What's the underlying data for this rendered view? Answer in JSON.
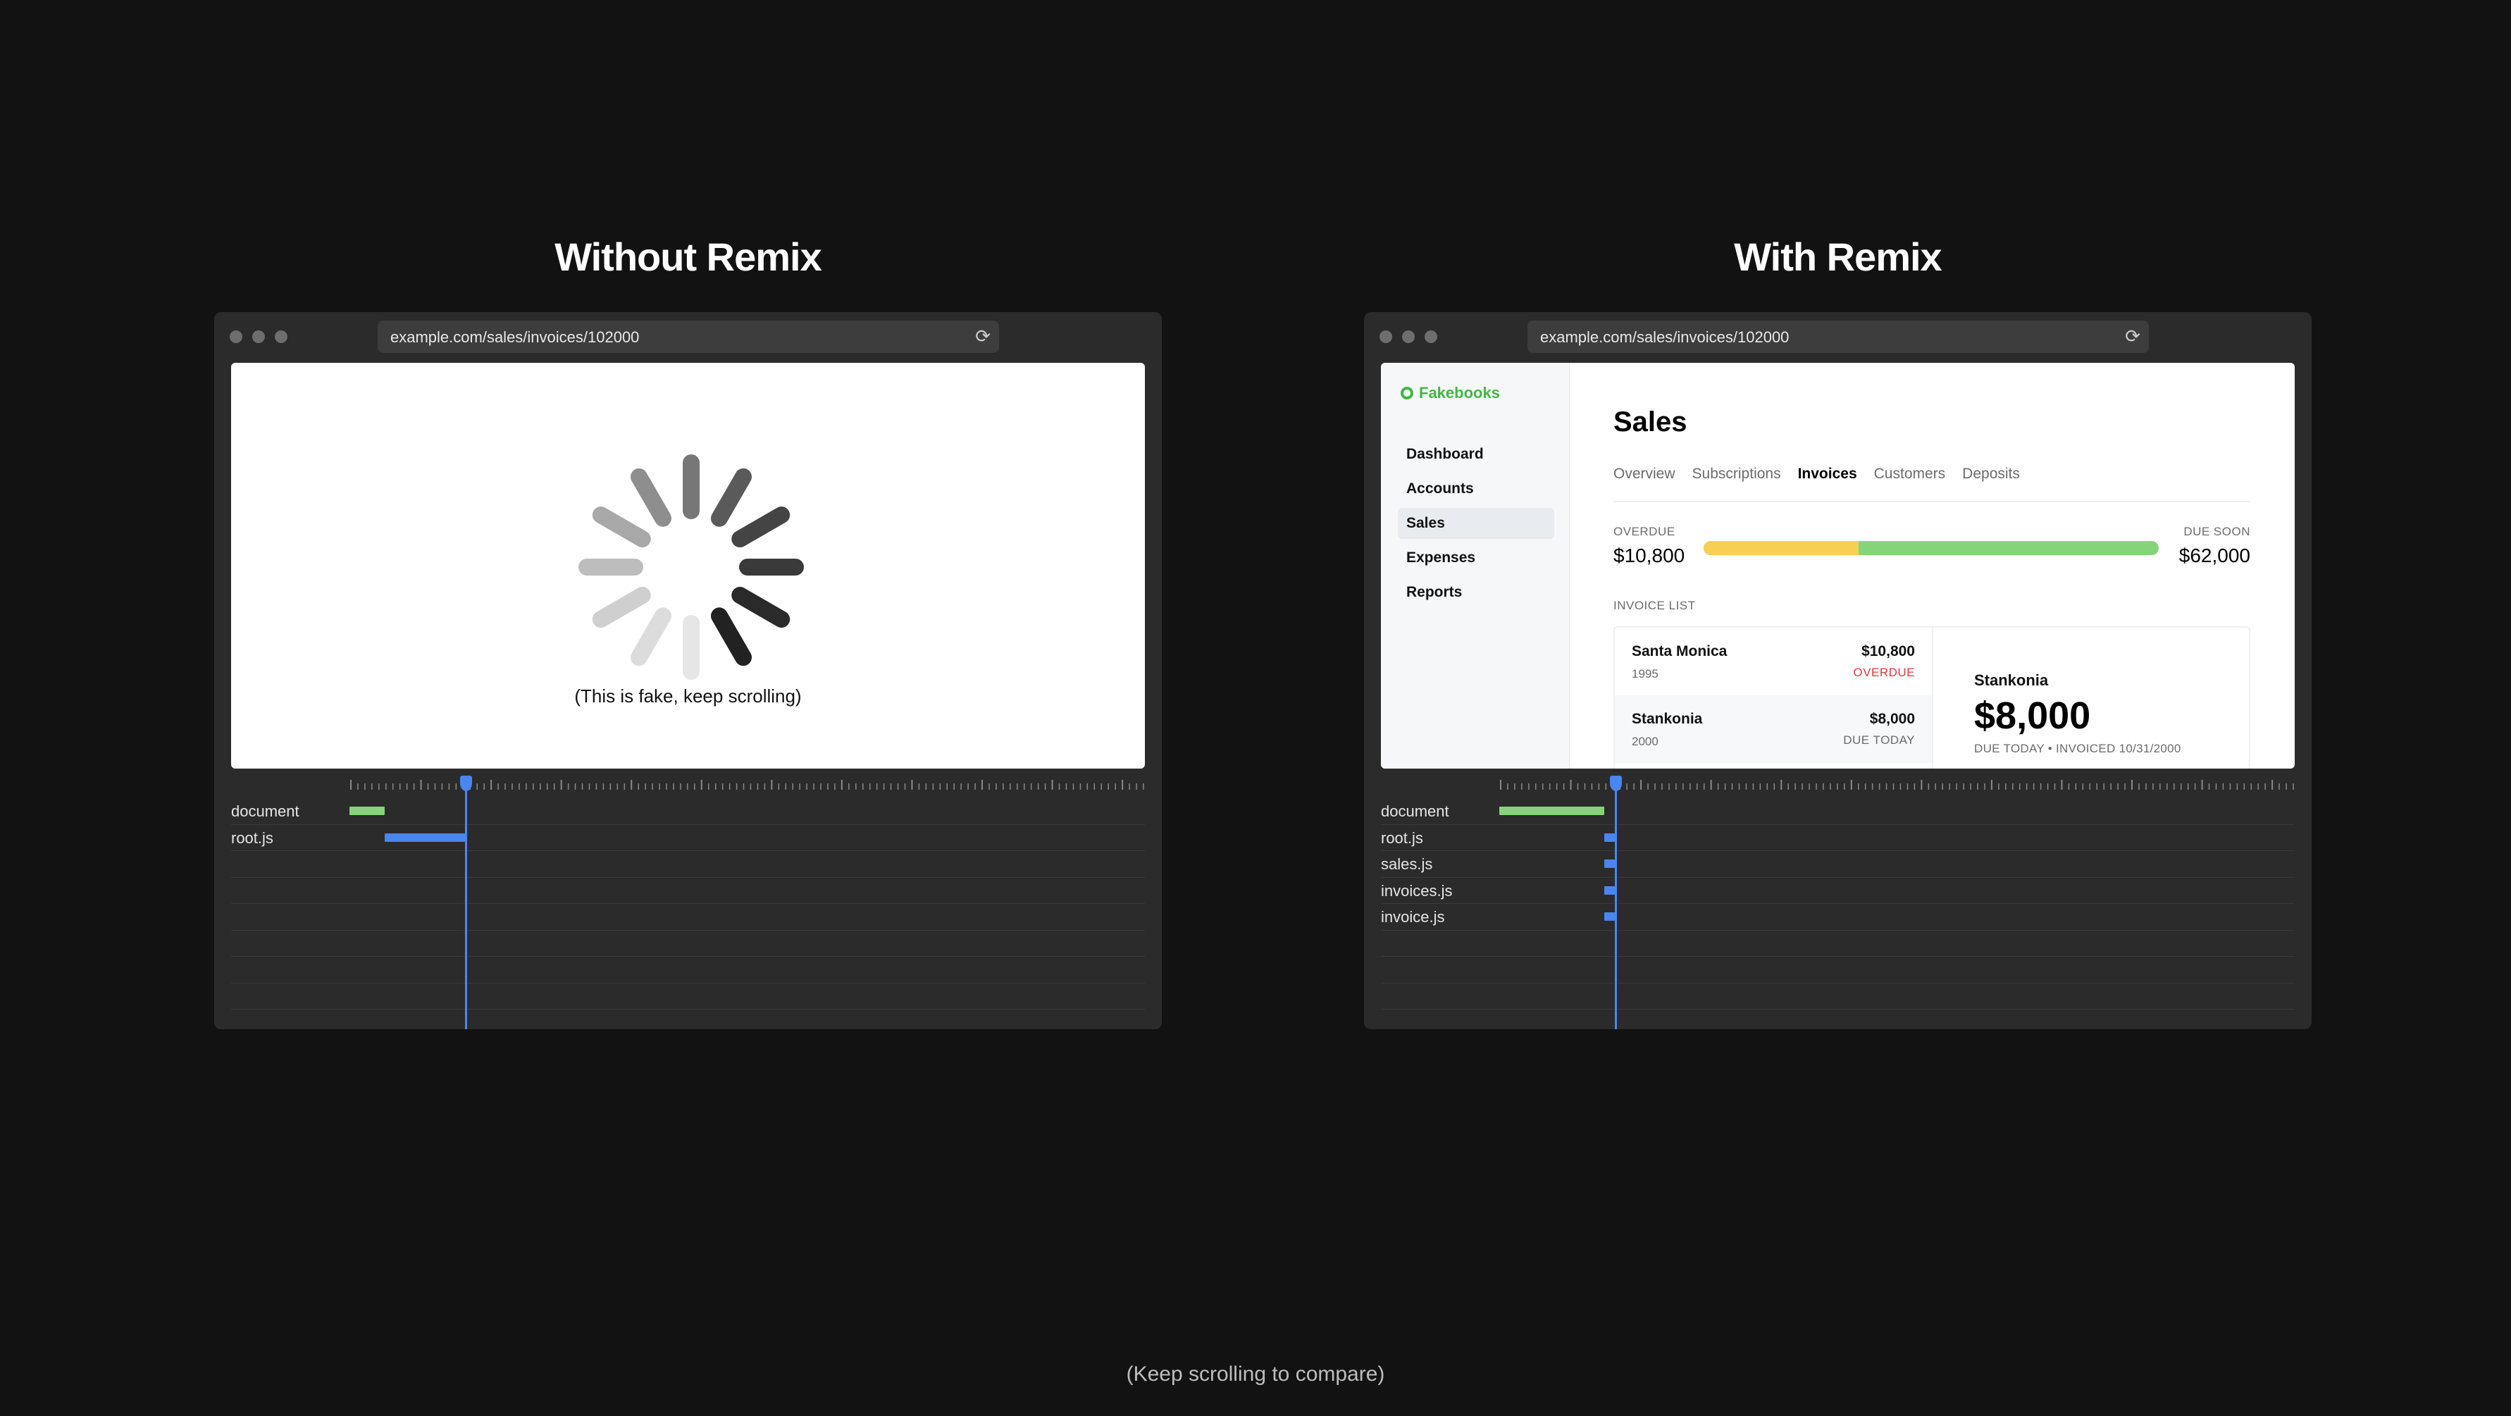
{
  "left": {
    "title": "Without Remix",
    "url": "example.com/sales/invoices/102000",
    "caption": "(This is fake, keep scrolling)",
    "timeline": {
      "rows": [
        {
          "label": "document",
          "color": "#86d47a",
          "start": 0.0,
          "end": 0.044
        },
        {
          "label": "root.js",
          "color": "#4a86f0",
          "start": 0.044,
          "end": 0.145
        },
        {
          "label": ""
        },
        {
          "label": ""
        },
        {
          "label": ""
        },
        {
          "label": ""
        },
        {
          "label": ""
        },
        {
          "label": ""
        }
      ],
      "playhead": 0.145
    }
  },
  "right": {
    "title": "With Remix",
    "url": "example.com/sales/invoices/102000",
    "app": {
      "brand": "Fakebooks",
      "nav": [
        "Dashboard",
        "Accounts",
        "Sales",
        "Expenses",
        "Reports"
      ],
      "active_nav": "Sales",
      "page_title": "Sales",
      "tabs": [
        "Overview",
        "Subscriptions",
        "Invoices",
        "Customers",
        "Deposits"
      ],
      "active_tab": "Invoices",
      "overdue_label": "OVERDUE",
      "overdue_value": "$10,800",
      "due_soon_label": "DUE SOON",
      "due_soon_value": "$62,000",
      "overdue_fraction": 0.34,
      "invoice_list_label": "INVOICE LIST",
      "invoices": [
        {
          "name": "Santa Monica",
          "year": "1995",
          "amount": "$10,800",
          "status": "OVERDUE"
        },
        {
          "name": "Stankonia",
          "year": "2000",
          "amount": "$8,000",
          "status": "DUE TODAY"
        }
      ],
      "detail": {
        "name": "Stankonia",
        "amount": "$8,000",
        "meta": "DUE TODAY • INVOICED 10/31/2000"
      }
    },
    "timeline": {
      "rows": [
        {
          "label": "document",
          "color": "#86d47a",
          "start": 0.0,
          "end": 0.132
        },
        {
          "label": "root.js",
          "color": "#4a86f0",
          "start": 0.132,
          "end": 0.145
        },
        {
          "label": "sales.js",
          "color": "#4a86f0",
          "start": 0.132,
          "end": 0.145
        },
        {
          "label": "invoices.js",
          "color": "#4a86f0",
          "start": 0.132,
          "end": 0.145
        },
        {
          "label": "invoice.js",
          "color": "#4a86f0",
          "start": 0.132,
          "end": 0.145
        },
        {
          "label": ""
        },
        {
          "label": ""
        },
        {
          "label": ""
        }
      ],
      "playhead": 0.145
    }
  },
  "footer": "(Keep scrolling to compare)"
}
